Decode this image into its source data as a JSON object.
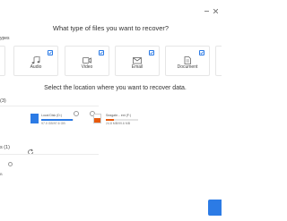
{
  "header": {
    "question_types": "What type of files you want to recover?",
    "types_label": "ypes"
  },
  "file_types": [
    {
      "label": "Audio",
      "icon": "music-note-icon",
      "checked": true
    },
    {
      "label": "Video",
      "icon": "video-icon",
      "checked": true
    },
    {
      "label": "Email",
      "icon": "email-icon",
      "checked": true
    },
    {
      "label": "Document",
      "icon": "document-icon",
      "checked": true
    }
  ],
  "location": {
    "question": "Select the location where you want to recover data.",
    "drives_section_label": "(3)",
    "other_section_label": "s (1)",
    "drives": [
      {
        "name": "Local Disk (D:)",
        "size": "97.0 GB/97.6 GB",
        "color": "#2c7be5",
        "usage_fraction": 0.98,
        "selected": false
      },
      {
        "name": "Seagate... ext (F:)",
        "size": "24.8 MB/99.6 MB",
        "color": "#e8590c",
        "usage_fraction": 0.25,
        "selected": false
      }
    ],
    "other_item_size": "B"
  },
  "colors": {
    "accent": "#2c7be5",
    "orange": "#e8590c"
  }
}
